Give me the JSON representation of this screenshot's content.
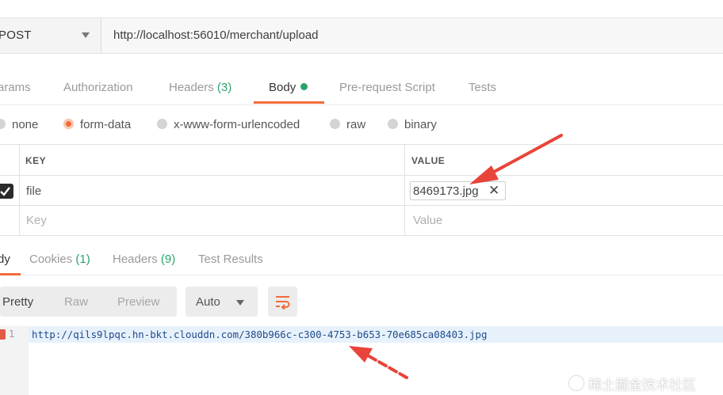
{
  "request": {
    "method": "POST",
    "url": "http://localhost:56010/merchant/upload"
  },
  "tabs": [
    {
      "label": "arams",
      "count": ""
    },
    {
      "label": "Authorization",
      "count": ""
    },
    {
      "label": "Headers ",
      "count": "(3)"
    },
    {
      "label": "Body",
      "count": ""
    },
    {
      "label": "Pre-request Script",
      "count": ""
    },
    {
      "label": "Tests",
      "count": ""
    }
  ],
  "body_types": [
    "none",
    "form-data",
    "x-www-form-urlencoded",
    "raw",
    "binary"
  ],
  "selected_body_type": "form-data",
  "kv_table": {
    "headers": {
      "key": "KEY",
      "value": "VALUE"
    },
    "rows": [
      {
        "checked": true,
        "key": "file",
        "value": "8469173.jpg"
      }
    ],
    "placeholder": {
      "key": "Key",
      "value": "Value"
    }
  },
  "response_tabs": [
    {
      "label": "dy",
      "count": ""
    },
    {
      "label": "Cookies ",
      "count": "(1)"
    },
    {
      "label": "Headers ",
      "count": "(9)"
    },
    {
      "label": "Test Results",
      "count": ""
    }
  ],
  "view_modes": [
    "Pretty",
    "Raw",
    "Preview"
  ],
  "format": "Auto",
  "response": {
    "line_number": "1",
    "text": "http://qils9lpqc.hn-bkt.clouddn.com/380b966c-c300-4753-b653-70e685ca08403.jpg"
  },
  "watermark": "稀土掘金技术社区",
  "colors": {
    "accent": "#f26b3a",
    "count_green": "#2aa36b",
    "annotation_red": "#e8443a"
  }
}
